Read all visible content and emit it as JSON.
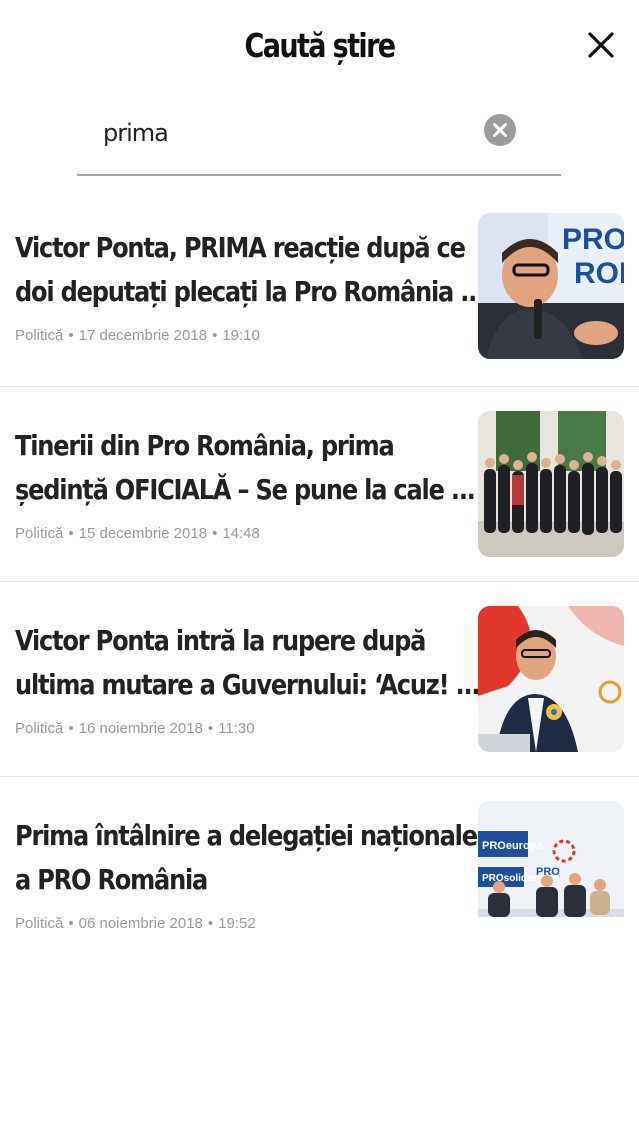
{
  "header": {
    "title": "Caută știre"
  },
  "search": {
    "value": "prima",
    "placeholder": ""
  },
  "icons": {
    "close": "close-icon",
    "clear": "clear-search-icon"
  },
  "results": [
    {
      "title_line1": "Victor Ponta, PRIMA reacție după ce",
      "title_line2": "doi deputați plecați la Pro România ...",
      "category": "Politică",
      "date": "17 decembrie 2018",
      "time": "19:10"
    },
    {
      "title_line1": "Tinerii din Pro România, prima",
      "title_line2": "ședință OFICIALĂ – Se pune la cale ...",
      "category": "Politică",
      "date": "15 decembrie 2018",
      "time": "14:48"
    },
    {
      "title_line1": "Victor Ponta intră la rupere după",
      "title_line2": "ultima mutare a Guvernului: ‘Acuz! ...",
      "category": "Politică",
      "date": "16 noiembrie 2018",
      "time": "11:30"
    },
    {
      "title_line1": "Prima întâlnire a delegației naționale",
      "title_line2": "a PRO România",
      "category": "Politică",
      "date": "06 noiembrie 2018",
      "time": "19:52"
    }
  ],
  "colors": {
    "caret": "#3a7bd5",
    "meta": "#9a9a9a",
    "underline": "#a9a9a9"
  }
}
